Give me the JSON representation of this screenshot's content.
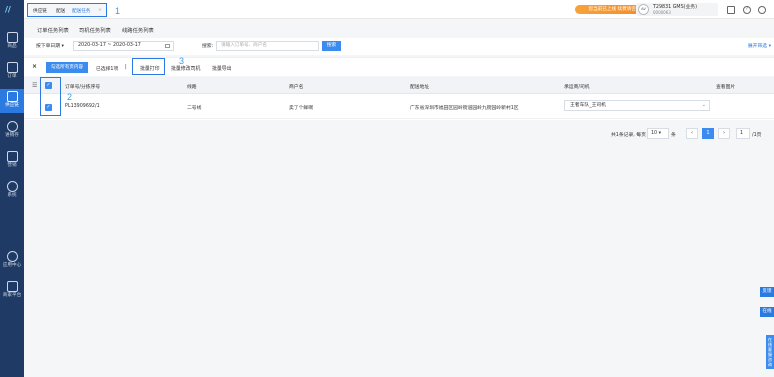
{
  "sidebar": {
    "logo": "//",
    "items": [
      {
        "label": "商品"
      },
      {
        "label": "订单"
      },
      {
        "label": "供应链"
      },
      {
        "label": "进销存"
      },
      {
        "label": "营销"
      },
      {
        "label": "系统"
      },
      {
        "label": "应用中心"
      },
      {
        "label": "商家平台"
      }
    ]
  },
  "breadcrumb": {
    "items": [
      "供应链",
      "配送",
      "配送任务"
    ],
    "close": "×"
  },
  "annotations": [
    "1",
    "2",
    "3"
  ],
  "header": {
    "promo": "您当前已上线 续费请咨询",
    "avatar_text": "AV",
    "user_name": "T29831 GMS(业务)",
    "user_id": "0000063"
  },
  "tabs": [
    "订单任务列表",
    "司机任务列表",
    "线路任务列表"
  ],
  "filters": {
    "date_select": "按下单日期",
    "date_range": "2020-03-17 ~ 2020-03-17",
    "search_label": "搜索:",
    "search_placeholder": "请输入订单号、商户名",
    "search_button": "搜索",
    "advanced": "展开筛选"
  },
  "actions": {
    "clear": "×",
    "select_all_pages": "勾选所有页内容",
    "selected": "已选择1项",
    "sep": "|",
    "batch_print": "批量打印",
    "batch_modify_driver": "批量修改司机",
    "batch_export": "批量导出"
  },
  "table": {
    "columns": [
      "订单号/分拣序号",
      "线路",
      "商户名",
      "配送地址",
      "承运商/司机",
      "查看图片"
    ],
    "rows": [
      {
        "order_no": "PL13909692/1",
        "route": "二号线",
        "merchant": "卖了个鲜啊",
        "address": "广东省深圳市福田区园岭街道园岭九街园岭新村1区",
        "driver": "王者车队_王司机"
      }
    ]
  },
  "pagination": {
    "total_text": "共1条记录, 每页",
    "page_size": "10",
    "unit": "条",
    "prev": "‹",
    "current": "1",
    "next": "›",
    "goto_value": "1",
    "total_pages": "/1页"
  },
  "floating": {
    "btn1": "反馈",
    "btn2": "在线",
    "side_tab": "在线客服咨询"
  }
}
